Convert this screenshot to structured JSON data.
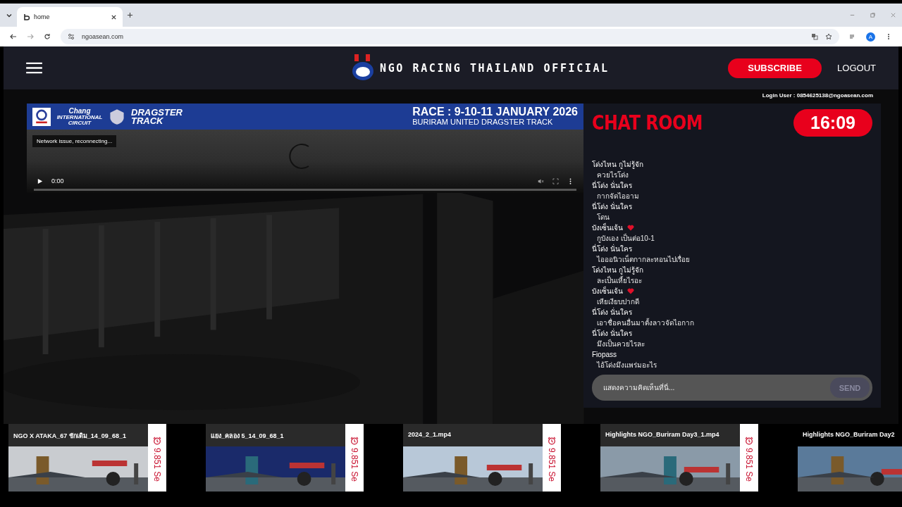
{
  "browser": {
    "tab_title": "home",
    "url": "ngoasean.com",
    "avatar": "A"
  },
  "header": {
    "brand": "NGO RACING THAILAND OFFICIAL",
    "subscribe": "SUBSCRIBE",
    "logout": "LOGOUT",
    "login_user": "Login User : 0854625138@ngoasean.com"
  },
  "video": {
    "sponsor_name": "Chang",
    "sponsor_sub": "INTERNATIONAL CIRCUIT",
    "track_logo": "DRAGSTER TRACK",
    "banner_title": "RACE : 9-10-11 JANUARY 2026",
    "banner_subtitle": "BURIRAM UNITED DRAGSTER TRACK",
    "status": "Network issue, reconnecting...",
    "time": "0:00",
    "muted": true
  },
  "chat": {
    "title": "CHAT ROOM",
    "clock": "16:09",
    "messages": [
      {
        "user": "โด่งไหน กูไม่รู้จัก",
        "heart": false,
        "text": "ควยไรโด่ง"
      },
      {
        "user": "นี่โด่ง นั่นใคร",
        "heart": false,
        "text": "กากจัดไออาม"
      },
      {
        "user": "นี่โด่ง นั่นใคร",
        "heart": false,
        "text": "โดน"
      },
      {
        "user": "บังเซ็นเจ้น",
        "heart": true,
        "text": "กูบังเอง เป็นต่อ10-1"
      },
      {
        "user": "นี่โด่ง นั่นใคร",
        "heart": false,
        "text": "ไอออนิวเน็ตกากละหอนไปเรื่อย"
      },
      {
        "user": "โด่งไหน กูไม่รู้จัก",
        "heart": false,
        "text": "ละเป็นเหี้ยไรอะ"
      },
      {
        "user": "บังเซ็นเจ้น",
        "heart": true,
        "text": "เหียเงียบปากดี"
      },
      {
        "user": "นี่โด่ง นั่นใคร",
        "heart": false,
        "text": "เอาชื่อคนอื่นมาตั้งลาวจัดไอกาก"
      },
      {
        "user": "นี่โด่ง นั่นใคร",
        "heart": false,
        "text": "มึงเป็นควยไรละ"
      },
      {
        "user": "Fiopass",
        "heart": false,
        "text": "ไอ้โด่งมึงแพร่มอะไร"
      }
    ],
    "placeholder": "แสดงความคิดเห็นที่นี่...",
    "send": "SEND"
  },
  "videos": [
    {
      "title": "NGO X ATAKA_67 ชักเดิม_14_09_68_1",
      "duration": "9.851 Se"
    },
    {
      "title": "แยง_คลอง 5_14_09_68_1",
      "duration": "9.851 Se"
    },
    {
      "title": "2024_2_1.mp4",
      "duration": "9.851 Se"
    },
    {
      "title": "Highlights NGO_Buriram Day3_1.mp4",
      "duration": "9.851 Se"
    },
    {
      "title": "Highlights NGO_Buriram Day2"
    }
  ]
}
